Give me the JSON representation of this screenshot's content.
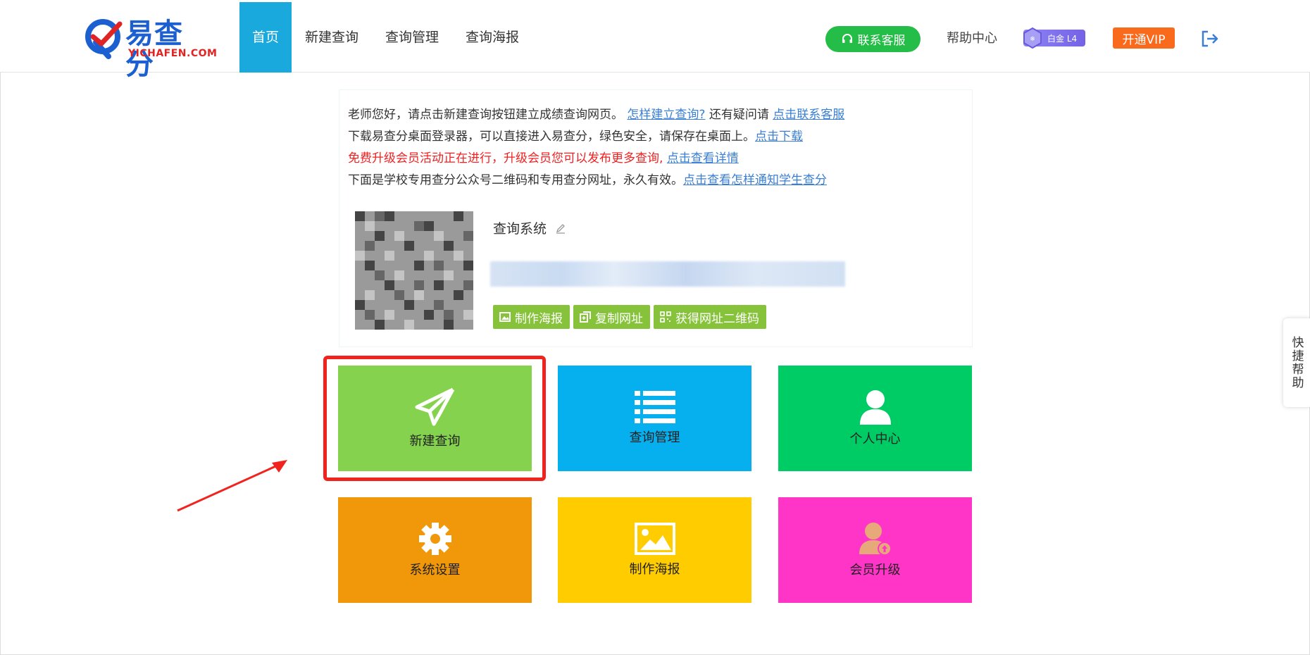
{
  "logo": {
    "main": "易查分",
    "sub": "YICHAFEN.COM"
  },
  "nav": {
    "items": [
      "首页",
      "新建查询",
      "查询管理",
      "查询海报"
    ],
    "active_index": 0
  },
  "header": {
    "contact_label": "联系客服",
    "help_label": "帮助中心",
    "level_label": "白金 L4",
    "vip_label": "开通VIP"
  },
  "notice": {
    "line1_text": "老师您好，请点击新建查询按钮建立成绩查询网页。",
    "line1_link1": "怎样建立查询?",
    "line1_mid": "还有疑问请",
    "line1_link2": "点击联系客服",
    "line2_text": "下载易查分桌面登录器，可以直接进入易查分，绿色安全，请保存在桌面上。",
    "line2_link": "点击下载",
    "line3_text": "免费升级会员活动正在进行，升级会员您可以发布更多查询,",
    "line3_link": "点击查看详情",
    "line4_text": "下面是学校专用查分公众号二维码和专用查分网址，永久有效。",
    "line4_link": "点击查看怎样通知学生查分"
  },
  "system": {
    "title": "查询系统",
    "buttons": [
      "制作海报",
      "复制网址",
      "获得网址二维码"
    ]
  },
  "tiles": [
    {
      "label": "新建查询",
      "color": "#85d24f",
      "icon": "paper-plane-icon"
    },
    {
      "label": "查询管理",
      "color": "#06b0ef",
      "icon": "list-icon"
    },
    {
      "label": "个人中心",
      "color": "#00cc66",
      "icon": "user-icon"
    },
    {
      "label": "系统设置",
      "color": "#f0980a",
      "icon": "gear-icon"
    },
    {
      "label": "制作海报",
      "color": "#ffcc00",
      "icon": "image-icon"
    },
    {
      "label": "会员升级",
      "color": "#ff35c8",
      "icon": "member-upgrade-icon"
    }
  ],
  "quick_help": "快捷帮助",
  "colors": {
    "highlight": "#f0231f",
    "accent_nav": "#19a9dc",
    "contact_green": "#23bd47",
    "vip_orange": "#fa6a1c"
  }
}
